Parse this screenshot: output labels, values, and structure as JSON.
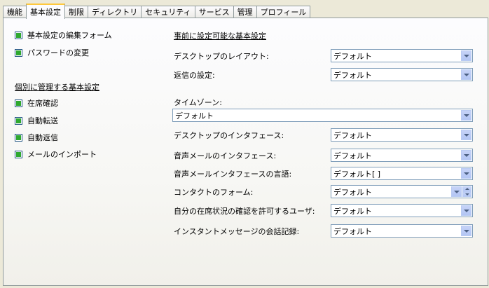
{
  "tabs": [
    "機能",
    "基本設定",
    "制限",
    "ディレクトリ",
    "セキュリティ",
    "サービス",
    "管理",
    "プロフィール"
  ],
  "active_tab": "基本設定",
  "left": {
    "checkbox_1": "基本設定の編集フォーム",
    "checkbox_2": "パスワードの変更",
    "section_title": "個別に管理する基本設定",
    "checkbox_3": "在席確認",
    "checkbox_4": "自動転送",
    "checkbox_5": "自動返信",
    "checkbox_6": "メールのインポート"
  },
  "right": {
    "section_title": "事前に設定可能な基本設定",
    "desktop_layout_label": "デスクトップのレイアウト:",
    "desktop_layout_value": "デフォルト",
    "reply_label": "返信の設定:",
    "reply_value": "デフォルト",
    "timezone_label": "タイムゾーン:",
    "timezone_value": "デフォルト",
    "desktop_interface_label": "デスクトップのインタフェース:",
    "desktop_interface_value": "デフォルト",
    "voicemail_interface_label": "音声メールのインタフェース:",
    "voicemail_interface_value": "デフォルト",
    "voicemail_language_label": "音声メールインタフェースの言語:",
    "voicemail_language_value": "デフォルト[ ]",
    "contact_form_label": "コンタクトのフォーム:",
    "contact_form_value": "デフォルト",
    "presence_users_label": "自分の在席状況の確認を許可するユーザ:",
    "presence_users_value": "デフォルト",
    "im_history_label": "インスタントメッセージの会話記録:",
    "im_history_value": "デフォルト"
  },
  "colors": {
    "checkbox_fill": "#2fa92f",
    "tab_highlight": "#ffc83c"
  }
}
